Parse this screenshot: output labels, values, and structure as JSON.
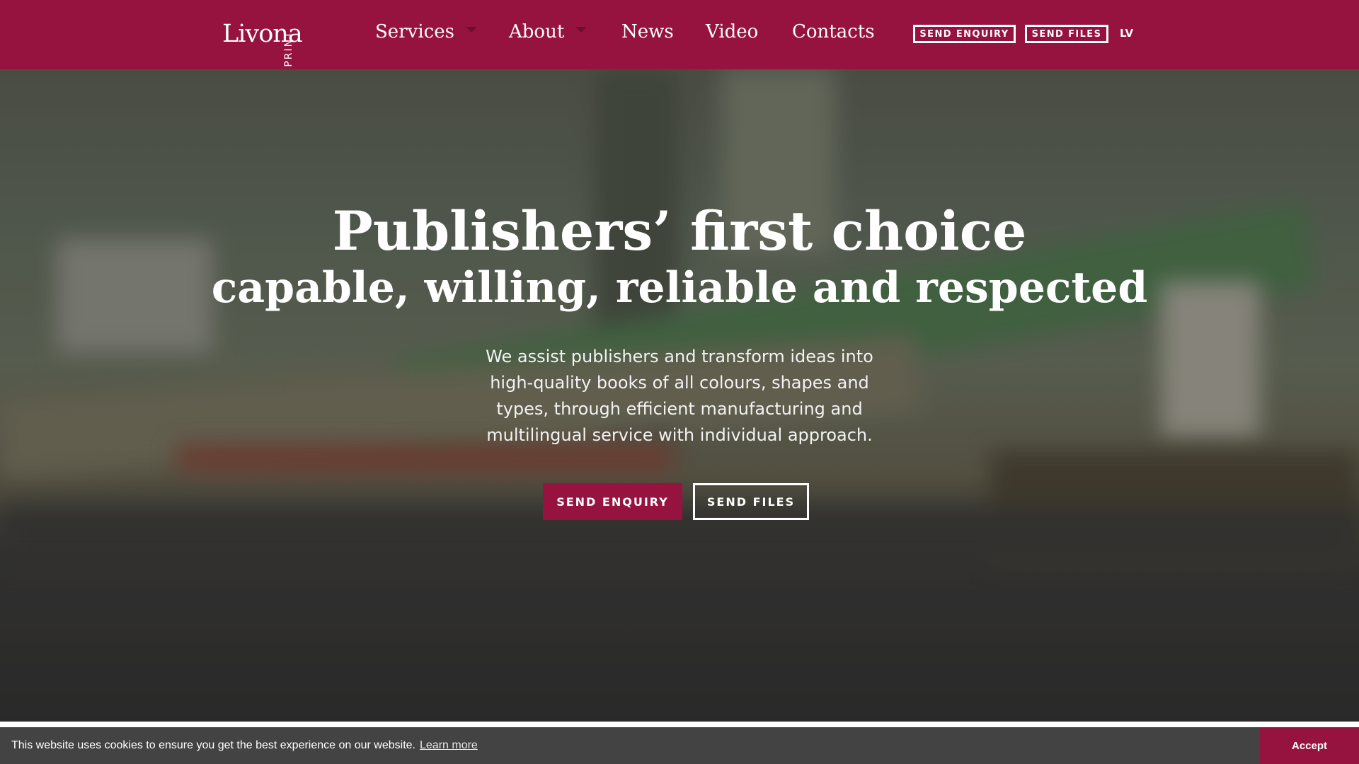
{
  "brand": {
    "name": "Livona",
    "sub": "PRINT"
  },
  "nav": {
    "items": [
      {
        "label": "Services",
        "has_dropdown": true
      },
      {
        "label": "About",
        "has_dropdown": true
      },
      {
        "label": "News",
        "has_dropdown": false
      },
      {
        "label": "Video",
        "has_dropdown": false
      },
      {
        "label": "Contacts",
        "has_dropdown": false
      }
    ],
    "send_enquiry": "SEND ENQUIRY",
    "send_files": "SEND FILES",
    "language": "LV"
  },
  "hero": {
    "headline": "Publishers’ first choice",
    "subheadline": "capable, willing, reliable and respected",
    "intro": "We assist publishers and transform ideas into high-quality books of all colours, shapes and types, through efficient manufacturing and multilingual service with individual approach.",
    "cta_primary": "SEND ENQUIRY",
    "cta_secondary": "SEND FILES"
  },
  "cookie": {
    "message": "This website uses cookies to ensure you get the best experience on our website.",
    "learn_more": "Learn more",
    "accept": "Accept"
  },
  "colors": {
    "brand": "#97133f",
    "cookie_bar": "#434343",
    "white": "#ffffff"
  },
  "icons": [
    "chevron-down-icon"
  ]
}
